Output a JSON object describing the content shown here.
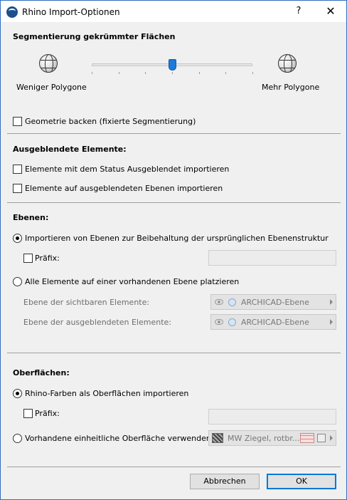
{
  "window": {
    "title": "Rhino Import-Optionen",
    "help_label": "?",
    "close_label": "✕"
  },
  "segmentation": {
    "heading": "Segmentierung gekrümmter Flächen",
    "left_label": "Weniger Polygone",
    "right_label": "Mehr Polygone",
    "slider_value": 0.5,
    "tick_count": 7,
    "bake_label": "Geometrie backen (fixierte Segmentierung)",
    "bake_checked": false
  },
  "hidden": {
    "heading": "Ausgeblendete Elemente:",
    "opt1_label": "Elemente mit dem Status Ausgeblendet importieren",
    "opt2_label": "Elemente auf ausgeblendeten Ebenen importieren"
  },
  "layers": {
    "heading": "Ebenen:",
    "radio1_label": "Importieren von Ebenen zur Beibehaltung der ursprünglichen Ebenenstruktur",
    "prefix_label": "Präfix:",
    "prefix_value": "",
    "radio2_label": "Alle Elemente auf einer vorhandenen Ebene platzieren",
    "visible_label": "Ebene der sichtbaren Elemente:",
    "visible_value": "ARCHICAD-Ebene",
    "hidden_label": "Ebene der ausgeblendeten Elemente:",
    "hidden_value": "ARCHICAD-Ebene"
  },
  "surfaces": {
    "heading": "Oberflächen:",
    "radio1_label": "Rhino-Farben als Oberflächen importieren",
    "prefix_label": "Präfix:",
    "prefix_value": "",
    "radio2_label": "Vorhandene einheitliche Oberfläche verwenden",
    "surface_value": "MW Ziegel, rotbr..."
  },
  "buttons": {
    "cancel": "Abbrechen",
    "ok": "OK"
  },
  "colors": {
    "accent": "#0078d7",
    "slider_thumb": "#1e7ad8"
  }
}
